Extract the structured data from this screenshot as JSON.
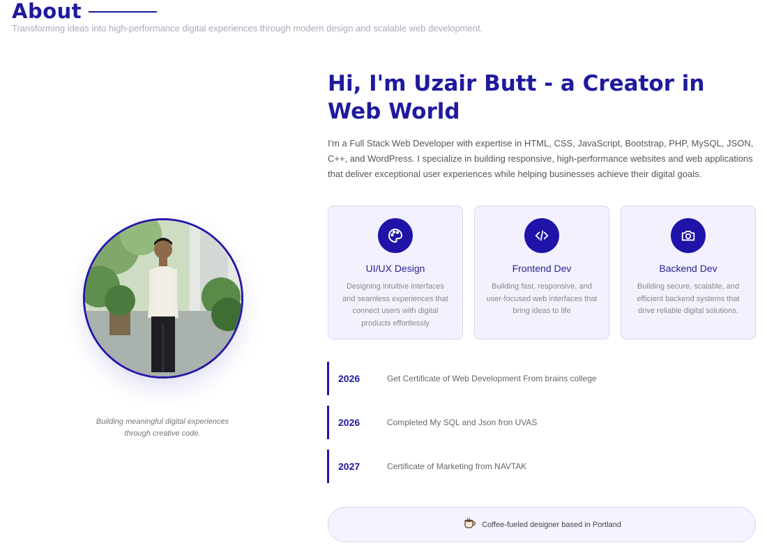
{
  "section": {
    "title": "About",
    "subtitle": "Transforming ideas into high-performance digital experiences through modern design and scalable web development."
  },
  "profile": {
    "caption": "Building meaningful digital experiences through creative code."
  },
  "intro": {
    "headline": "Hi, I'm Uzair Butt - a Creator in Web World",
    "bio": "I'm a Full Stack Web Developer with expertise in HTML, CSS, JavaScript, Bootstrap, PHP, MySQL, JSON, C++, and WordPress. I specialize in building responsive, high-performance websites and web applications that deliver exceptional user experiences while helping businesses achieve their digital goals."
  },
  "services": [
    {
      "icon": "palette-icon",
      "title": "UI/UX Design",
      "description": "Designing intuitive interfaces and seamless experiences that connect users with digital products effortlessly"
    },
    {
      "icon": "code-icon",
      "title": "Frontend Dev",
      "description": "Building fast, responsive, and user-focused web interfaces that bring ideas to life"
    },
    {
      "icon": "camera-icon",
      "title": "Backend Dev",
      "description": "Building secure, scalable, and efficient backend systems that drive reliable digital solutions."
    }
  ],
  "timeline": [
    {
      "year": "2026",
      "text": "Get Certificate of Web Development From brains college"
    },
    {
      "year": "2026",
      "text": "Completed My SQL and Json fron UVAS"
    },
    {
      "year": "2027",
      "text": "Certificate of Marketing from NAVTAK"
    }
  ],
  "footer_pill": {
    "icon": "coffee-cup-icon",
    "text": "Coffee-fueled designer based in Portland"
  },
  "colors": {
    "accent": "#1f1a9e",
    "card_bg": "#f3f1fe"
  }
}
